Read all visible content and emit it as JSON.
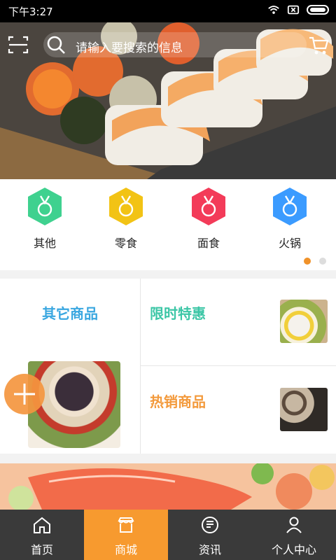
{
  "status_bar": {
    "time": "下午3:27"
  },
  "search": {
    "placeholder": "请输入要搜索的信息"
  },
  "categories": [
    {
      "label": "其他",
      "color": "#3fd18f"
    },
    {
      "label": "零食",
      "color": "#f2c315"
    },
    {
      "label": "面食",
      "color": "#f33b59"
    },
    {
      "label": "火锅",
      "color": "#3b9bff"
    }
  ],
  "carousel": {
    "active_index": 0,
    "count": 2
  },
  "promo": {
    "left_title": "其它商品",
    "right_top_title": "限时特惠",
    "right_bottom_title": "热销商品"
  },
  "tabs": [
    {
      "label": "首页",
      "icon": "home-icon"
    },
    {
      "label": "商城",
      "icon": "store-icon",
      "active": true
    },
    {
      "label": "资讯",
      "icon": "news-icon"
    },
    {
      "label": "个人中心",
      "icon": "user-icon"
    }
  ]
}
